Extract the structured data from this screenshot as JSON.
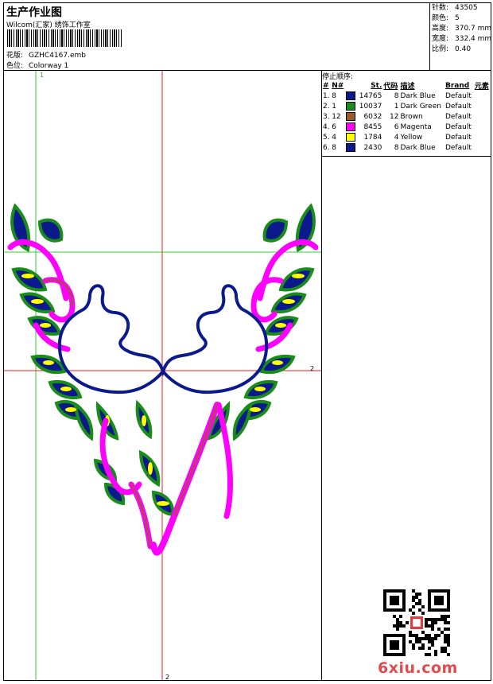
{
  "header": {
    "title": "生产作业图",
    "company": "Wilcom(汇家) 绣饰工作室",
    "design_label": "花版:",
    "design_value": "GZHC4167.emb",
    "colorway_label": "色位:",
    "colorway_value": "Colorway 1"
  },
  "stats": [
    {
      "label": "针数:",
      "value": "43505"
    },
    {
      "label": "颜色:",
      "value": "5"
    },
    {
      "label": "高度:",
      "value": "370.7 mm"
    },
    {
      "label": "宽度:",
      "value": "332.4 mm"
    },
    {
      "label": "比例:",
      "value": "0.40"
    }
  ],
  "stop_sequence": {
    "title": "停止顺序:",
    "columns": [
      "#",
      "N#",
      "St.",
      "代码",
      "描述",
      "Brand",
      "元素"
    ],
    "rows": [
      {
        "idx": "1.",
        "n": "8",
        "color": "#0a1a8c",
        "st": "14765",
        "code": "8",
        "desc": "Dark Blue",
        "brand": "Default"
      },
      {
        "idx": "2.",
        "n": "1",
        "color": "#1a8c1a",
        "st": "10037",
        "code": "1",
        "desc": "Dark Green",
        "brand": "Default"
      },
      {
        "idx": "3.",
        "n": "12",
        "color": "#9c5a2a",
        "st": "6032",
        "code": "12",
        "desc": "Brown",
        "brand": "Default"
      },
      {
        "idx": "4.",
        "n": "6",
        "color": "#ff00ff",
        "st": "8455",
        "code": "6",
        "desc": "Magenta",
        "brand": "Default"
      },
      {
        "idx": "5.",
        "n": "4",
        "color": "#ffff00",
        "st": "1784",
        "code": "4",
        "desc": "Yellow",
        "brand": "Default"
      },
      {
        "idx": "6.",
        "n": "8",
        "color": "#0a1a8c",
        "st": "2430",
        "code": "8",
        "desc": "Dark Blue",
        "brand": "Default"
      }
    ]
  },
  "canvas": {
    "guide_labels": {
      "top": "1",
      "right": "2",
      "bottom": "2"
    }
  },
  "colors": {
    "dark_blue": "#0a1a8c",
    "dark_green": "#1a8c1a",
    "magenta": "#ff00ff",
    "yellow": "#ffff00",
    "brown": "#9c5a2a",
    "green_guide": "#33cc33",
    "red_guide": "#ee2222"
  },
  "watermark": "6xiu.com"
}
